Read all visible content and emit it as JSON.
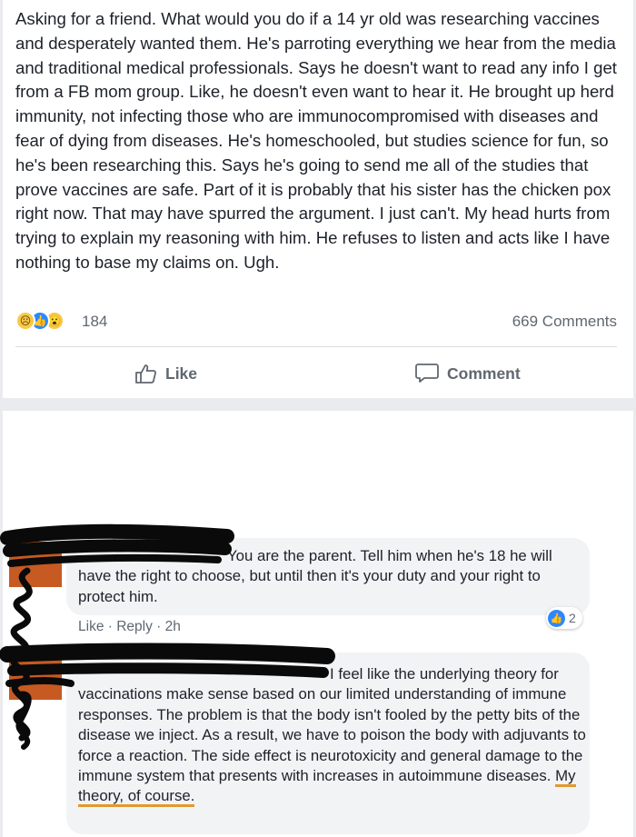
{
  "post": {
    "text": "Asking for a friend. What would you do if a 14 yr old was researching vaccines and desperately wanted them. He's parroting everything we hear from the media and traditional medical professionals. Says he doesn't want to read any info I get from a FB mom group. Like, he doesn't even want to hear it. He brought up herd immunity, not infecting those who are immunocompromised with diseases and fear of dying from diseases. He's homeschooled, but studies science for fun, so he's been researching this. Says he's going to send me all of the studies that prove vaccines are safe. Part of it is probably that his sister has the chicken pox right now. That may have spurred the argument. I just can't. My head hurts from trying to explain my reasoning with him. He refuses to listen and acts like I have nothing to base my claims on. Ugh.",
    "reaction_count": "184",
    "comments_count": "669 Comments",
    "reaction_icons": [
      "sad-icon",
      "like-icon",
      "wow-icon"
    ]
  },
  "actions": {
    "like_label": "Like",
    "comment_label": "Comment"
  },
  "comments": [
    {
      "text": "You are the parent. Tell him when he's 18 he will have the right to choose, but until then it's your duty and your right to protect him.",
      "like_label": "Like",
      "separator": " · ",
      "reply_label": "Reply",
      "time": "2h",
      "reaction_count": "2"
    },
    {
      "text": "I feel like the underlying theory for vaccinations make sense based on our limited understanding of immune responses. The problem is that the body isn't fooled by the petty bits of the disease we inject. As a result, we have to poison the body with adjuvants to force a reaction. The side effect is neurotoxicity and general damage to the immune system that presents with increases in autoimmune diseases. ",
      "highlighted": "My theory, of course."
    }
  ],
  "colors": {
    "link_blue": "#2d88ff",
    "meta_gray": "#606770",
    "bubble_bg": "#f2f3f5",
    "highlight": "#e09a2c"
  }
}
